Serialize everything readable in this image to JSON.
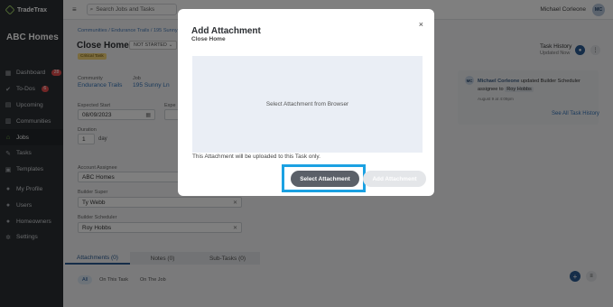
{
  "brand": "TradeTrax",
  "company": "ABC Homes",
  "sidebar": {
    "items": [
      {
        "label": "Dashboard",
        "icon": "dashboard-icon",
        "glyph": "▦",
        "badge": "28"
      },
      {
        "label": "To-Dos",
        "icon": "todo-icon",
        "glyph": "✔",
        "badge": "6"
      },
      {
        "label": "Upcoming",
        "icon": "calendar-icon",
        "glyph": "▤"
      },
      {
        "label": "Communities",
        "icon": "communities-icon",
        "glyph": "▥"
      },
      {
        "label": "Jobs",
        "icon": "home-icon",
        "glyph": "⌂",
        "active": true
      },
      {
        "label": "Tasks",
        "icon": "wrench-icon",
        "glyph": "✎"
      },
      {
        "label": "Templates",
        "icon": "templates-icon",
        "glyph": "▣"
      },
      {
        "label": "My Profile",
        "icon": "profile-icon",
        "glyph": "●"
      },
      {
        "label": "Users",
        "icon": "users-icon",
        "glyph": "●"
      },
      {
        "label": "Homeowners",
        "icon": "homeowners-icon",
        "glyph": "●"
      },
      {
        "label": "Settings",
        "icon": "gear-icon",
        "glyph": "✲"
      }
    ]
  },
  "topbar": {
    "search_placeholder": "Search Jobs and Tasks",
    "user_name": "Michael Corleone",
    "user_initials": "MC"
  },
  "page": {
    "breadcrumb": "Communities / Endurance Trails / 195 Sunny Ln",
    "title": "Close Home",
    "status": "NOT STARTED",
    "tag": "Critical Task",
    "community_label": "Community",
    "community": "Endurance Trails",
    "job_label": "Job",
    "job": "195 Sunny Ln",
    "expected_start_label": "Expected Start",
    "expected_start": "08/09/2023",
    "expected_end_label": "Expe",
    "duration_label": "Duration",
    "duration": "1",
    "duration_unit": "day",
    "account_assignee_label": "Account Assignee",
    "account_assignee": "ABC Homes",
    "builder_super_label": "Builder Super",
    "builder_super": "Ty Webb",
    "builder_scheduler_label": "Builder Scheduler",
    "builder_scheduler": "Roy Hobbs"
  },
  "history": {
    "title": "Task History",
    "sub": "Updated Now",
    "entry_initials": "MC",
    "entry_user": "Michael Corleone",
    "entry_text": "updated Builder Scheduler assignee to",
    "entry_value": "Roy Hobbs",
    "entry_time": "August 9 at 4:09pm",
    "see_all": "See All Task History"
  },
  "tabs": [
    "Attachments (0)",
    "Notes (0)",
    "Sub-Tasks (0)"
  ],
  "subtabs": [
    "All",
    "On This Task",
    "On The Job"
  ],
  "modal": {
    "title": "Add Attachment",
    "subtitle": "Close Home",
    "dropzone": "Select Attachment from Browser",
    "note": "This Attachment will be uploaded to this Task only.",
    "primary": "Select Attachment",
    "secondary": "Add Attachment",
    "close": "×"
  },
  "colors": {
    "sidebar_bg": "#2b2f33",
    "accent_blue": "#3473b7",
    "highlight": "#1ba1e2",
    "primary_btn": "#5b6068"
  }
}
